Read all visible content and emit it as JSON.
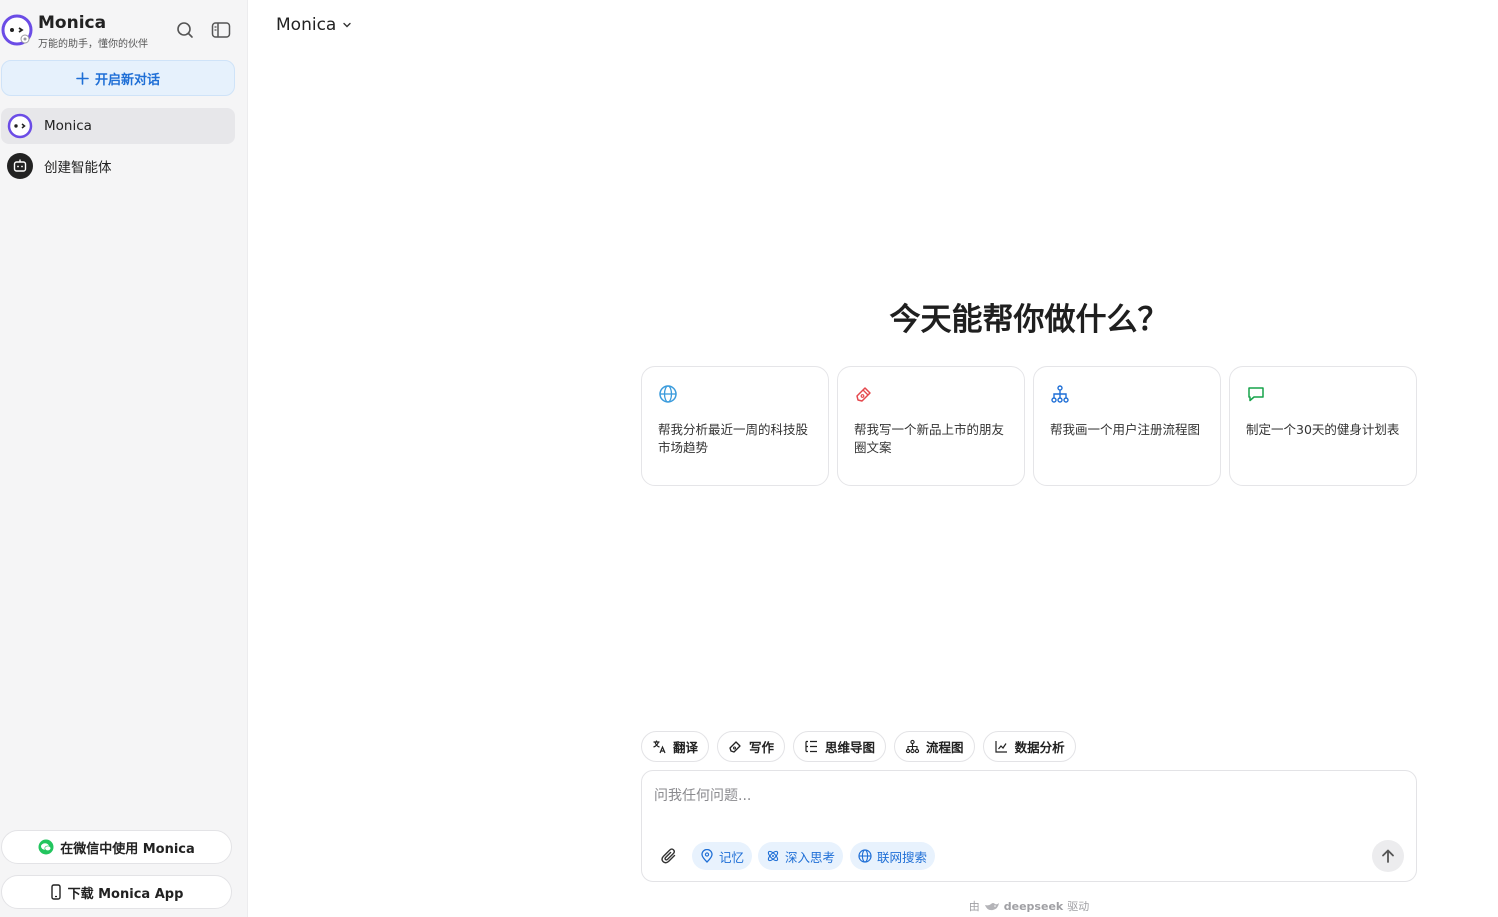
{
  "sidebar": {
    "brand_name": "Monica",
    "brand_tagline": "万能的助手，懂你的伙伴",
    "new_chat_label": "开启新对话",
    "items": [
      {
        "label": "Monica"
      },
      {
        "label": "创建智能体"
      }
    ],
    "wechat_label": "在微信中使用 Monica",
    "download_label": "下载 Monica App"
  },
  "header": {
    "model_name": "Monica"
  },
  "main": {
    "headline": "今天能帮你做什么？",
    "cards": [
      {
        "text": "帮我分析最近一周的科技股市场趋势",
        "icon": "globe-icon",
        "color": "#3a9bdc"
      },
      {
        "text": "帮我写一个新品上市的朋友圈文案",
        "icon": "pen-icon",
        "color": "#e5484d"
      },
      {
        "text": "帮我画一个用户注册流程图",
        "icon": "flowchart-icon",
        "color": "#1f6fd6"
      },
      {
        "text": "制定一个30天的健身计划表",
        "icon": "chat-icon",
        "color": "#16a34a"
      }
    ],
    "chips": [
      {
        "label": "翻译"
      },
      {
        "label": "写作"
      },
      {
        "label": "思维导图"
      },
      {
        "label": "流程图"
      },
      {
        "label": "数据分析"
      }
    ],
    "composer": {
      "placeholder": "问我任何问题...",
      "tools": [
        {
          "label": "记忆"
        },
        {
          "label": "深入思考"
        },
        {
          "label": "联网搜索"
        }
      ]
    },
    "footer": {
      "prefix": "由",
      "brand": "deepseek",
      "suffix": "驱动"
    }
  },
  "colors": {
    "accent": "#1f6fd6",
    "sidebar_bg": "#f5f5f6"
  }
}
